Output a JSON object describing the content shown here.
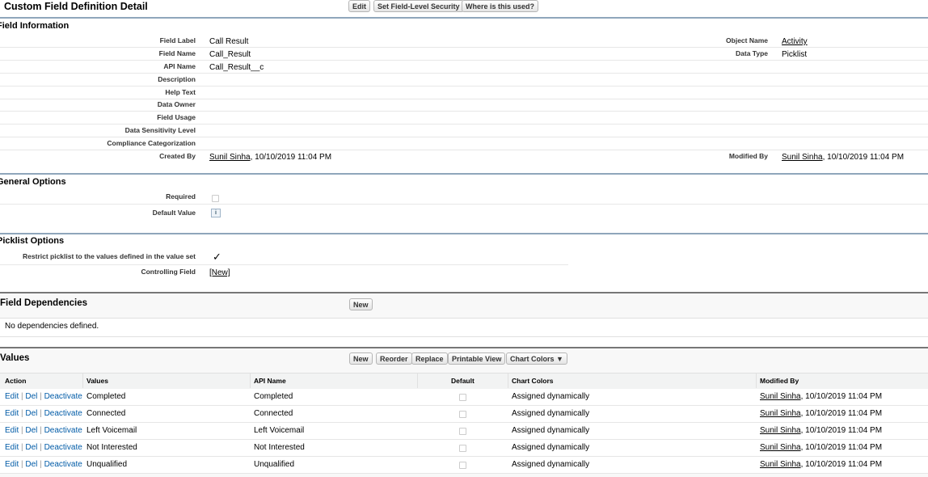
{
  "header": {
    "title": "Custom Field Definition Detail",
    "buttons": [
      "Edit",
      "Set Field-Level Security",
      "Where is this used?"
    ]
  },
  "field_info": {
    "heading": "Field Information",
    "left_rows": [
      {
        "label": "Field Label",
        "value": "Call Result"
      },
      {
        "label": "Field Name",
        "value": "Call_Result"
      },
      {
        "label": "API Name",
        "value": "Call_Result__c"
      },
      {
        "label": "Description",
        "value": ""
      },
      {
        "label": "Help Text",
        "value": ""
      },
      {
        "label": "Data Owner",
        "value": ""
      },
      {
        "label": "Field Usage",
        "value": ""
      },
      {
        "label": "Data Sensitivity Level",
        "value": ""
      },
      {
        "label": "Compliance Categorization",
        "value": ""
      }
    ],
    "object_name_label": "Object Name",
    "object_name_value": "Activity",
    "data_type_label": "Data Type",
    "data_type_value": "Picklist",
    "created_by_label": "Created By",
    "created_by_user": "Sunil Sinha",
    "created_by_date": ", 10/10/2019 11:04 PM",
    "modified_by_label": "Modified By",
    "modified_by_user": "Sunil Sinha",
    "modified_by_date": ", 10/10/2019 11:04 PM"
  },
  "general_options": {
    "heading": "General Options",
    "required_label": "Required",
    "default_value_label": "Default Value"
  },
  "picklist_options": {
    "heading": "Picklist Options",
    "restrict_label": "Restrict picklist to the values defined in the value set",
    "restrict_mark": "✓",
    "controlling_field_label": "Controlling Field",
    "controlling_field_value": "[New]"
  },
  "field_dependencies": {
    "heading": "Field Dependencies",
    "new_button": "New",
    "empty_text": "No dependencies defined."
  },
  "values": {
    "heading": "Values",
    "buttons": [
      "New",
      "Reorder",
      "Replace",
      "Printable View",
      "Chart Colors ▼"
    ],
    "columns": [
      "Action",
      "Values",
      "API Name",
      "Default",
      "Chart Colors",
      "Modified By"
    ],
    "action_links": [
      "Edit",
      "Del",
      "Deactivate"
    ],
    "rows": [
      {
        "value": "Completed",
        "api_name": "Completed",
        "chart_color": "Assigned dynamically",
        "modified_user": "Sunil Sinha",
        "modified_date": ", 10/10/2019 11:04 PM"
      },
      {
        "value": "Connected",
        "api_name": "Connected",
        "chart_color": "Assigned dynamically",
        "modified_user": "Sunil Sinha",
        "modified_date": ", 10/10/2019 11:04 PM"
      },
      {
        "value": "Left Voicemail",
        "api_name": "Left Voicemail",
        "chart_color": "Assigned dynamically",
        "modified_user": "Sunil Sinha",
        "modified_date": ", 10/10/2019 11:04 PM"
      },
      {
        "value": "Not Interested",
        "api_name": "Not Interested",
        "chart_color": "Assigned dynamically",
        "modified_user": "Sunil Sinha",
        "modified_date": ", 10/10/2019 11:04 PM"
      },
      {
        "value": "Unqualified",
        "api_name": "Unqualified",
        "chart_color": "Assigned dynamically",
        "modified_user": "Sunil Sinha",
        "modified_date": ", 10/10/2019 11:04 PM"
      }
    ]
  }
}
